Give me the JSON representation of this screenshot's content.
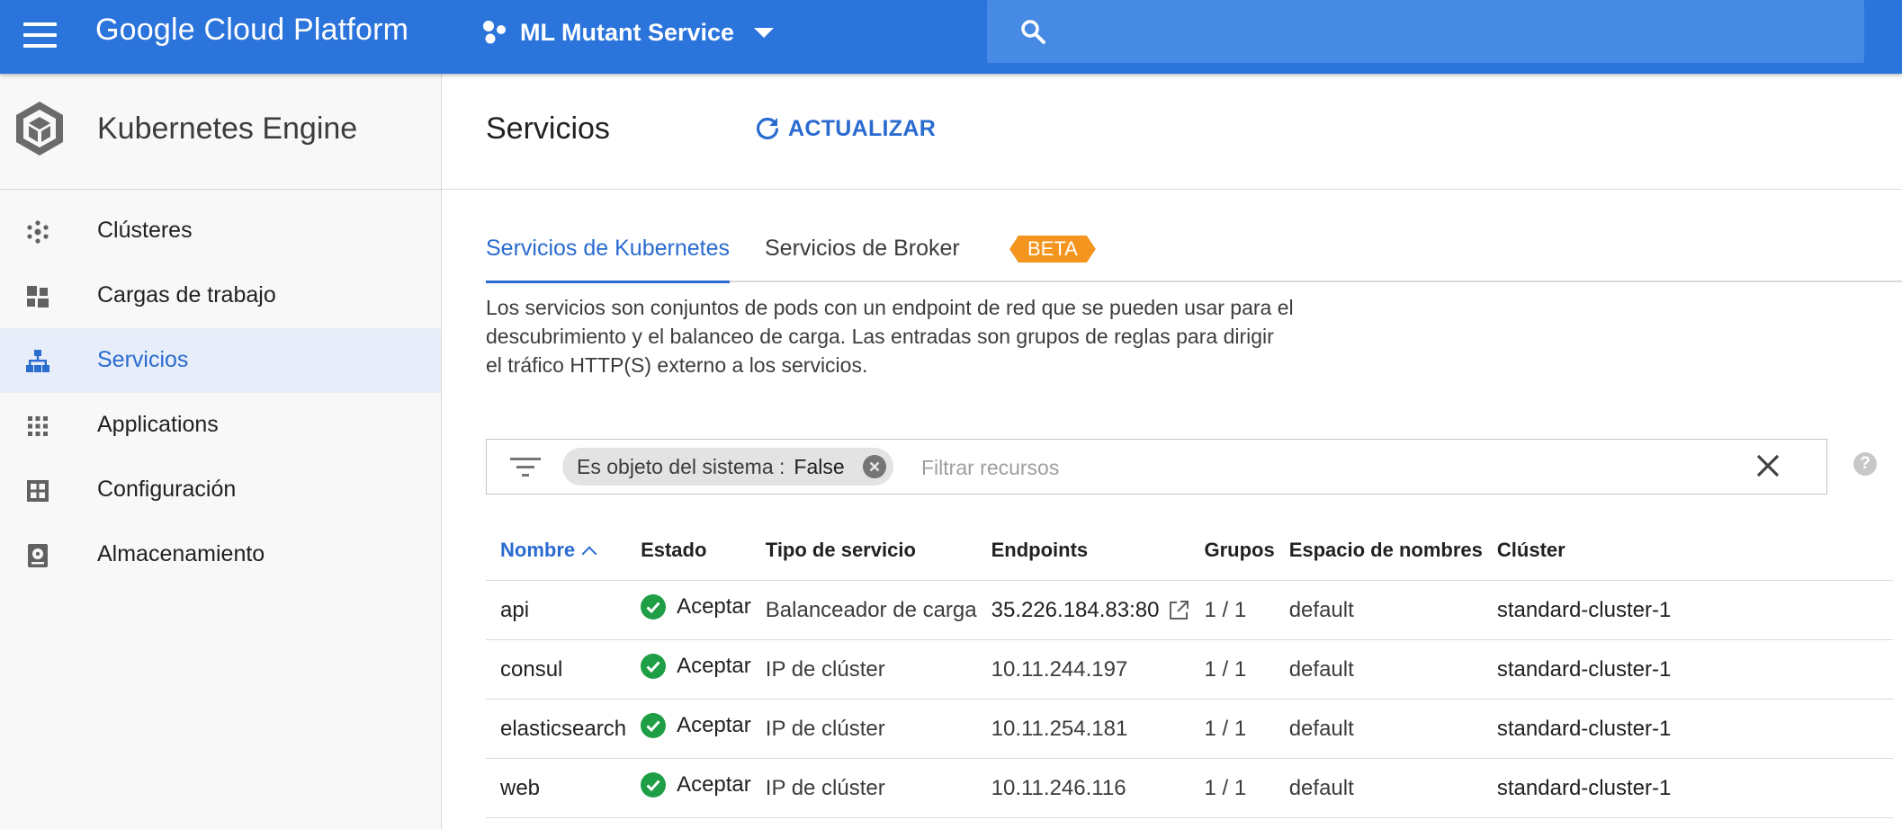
{
  "topbar": {
    "brand": "Google Cloud Platform",
    "project": "ML Mutant Service",
    "colors": {
      "bar": "#2a74dc",
      "search": "#478ae4"
    }
  },
  "sidebar": {
    "title": "Kubernetes Engine",
    "items": [
      {
        "label": "Clústeres",
        "icon": "clusters-icon",
        "active": false
      },
      {
        "label": "Cargas de trabajo",
        "icon": "workloads-icon",
        "active": false
      },
      {
        "label": "Servicios",
        "icon": "services-icon",
        "active": true
      },
      {
        "label": "Applications",
        "icon": "apps-grid-icon",
        "active": false
      },
      {
        "label": "Configuración",
        "icon": "configuration-icon",
        "active": false
      },
      {
        "label": "Almacenamiento",
        "icon": "storage-icon",
        "active": false
      }
    ]
  },
  "main": {
    "title": "Servicios",
    "refresh_label": "ACTUALIZAR",
    "tabs": [
      {
        "label": "Servicios de Kubernetes",
        "selected": true
      },
      {
        "label": "Servicios de Broker",
        "selected": false,
        "badge": "BETA"
      }
    ],
    "description": "Los servicios son conjuntos de pods con un endpoint de red que se pueden usar para el descubrimiento y el balanceo de carga. Las entradas son grupos de reglas para dirigir el tráfico HTTP(S) externo a los servicios.",
    "filter": {
      "chip_key": "Es objeto del sistema :",
      "chip_value": "False",
      "placeholder": "Filtrar recursos",
      "help": "?"
    },
    "table": {
      "columns": [
        "Nombre",
        "Estado",
        "Tipo de servicio",
        "Endpoints",
        "Grupos",
        "Espacio de nombres",
        "Clúster"
      ],
      "sorted_column": "Nombre",
      "rows": [
        {
          "name": "api",
          "status": "Aceptar",
          "type": "Balanceador de carga",
          "endpoint": "35.226.184.83:80",
          "endpoint_link": true,
          "groups": "1 / 1",
          "namespace": "default",
          "cluster": "standard-cluster-1"
        },
        {
          "name": "consul",
          "status": "Aceptar",
          "type": "IP de clúster",
          "endpoint": "10.11.244.197",
          "endpoint_link": false,
          "groups": "1 / 1",
          "namespace": "default",
          "cluster": "standard-cluster-1"
        },
        {
          "name": "elasticsearch",
          "status": "Aceptar",
          "type": "IP de clúster",
          "endpoint": "10.11.254.181",
          "endpoint_link": false,
          "groups": "1 / 1",
          "namespace": "default",
          "cluster": "standard-cluster-1"
        },
        {
          "name": "web",
          "status": "Aceptar",
          "type": "IP de clúster",
          "endpoint": "10.11.246.116",
          "endpoint_link": false,
          "groups": "1 / 1",
          "namespace": "default",
          "cluster": "standard-cluster-1"
        }
      ]
    },
    "colors": {
      "accent": "#2a6bd0",
      "ok": "#1e9e45",
      "beta": "#f3951e"
    }
  }
}
